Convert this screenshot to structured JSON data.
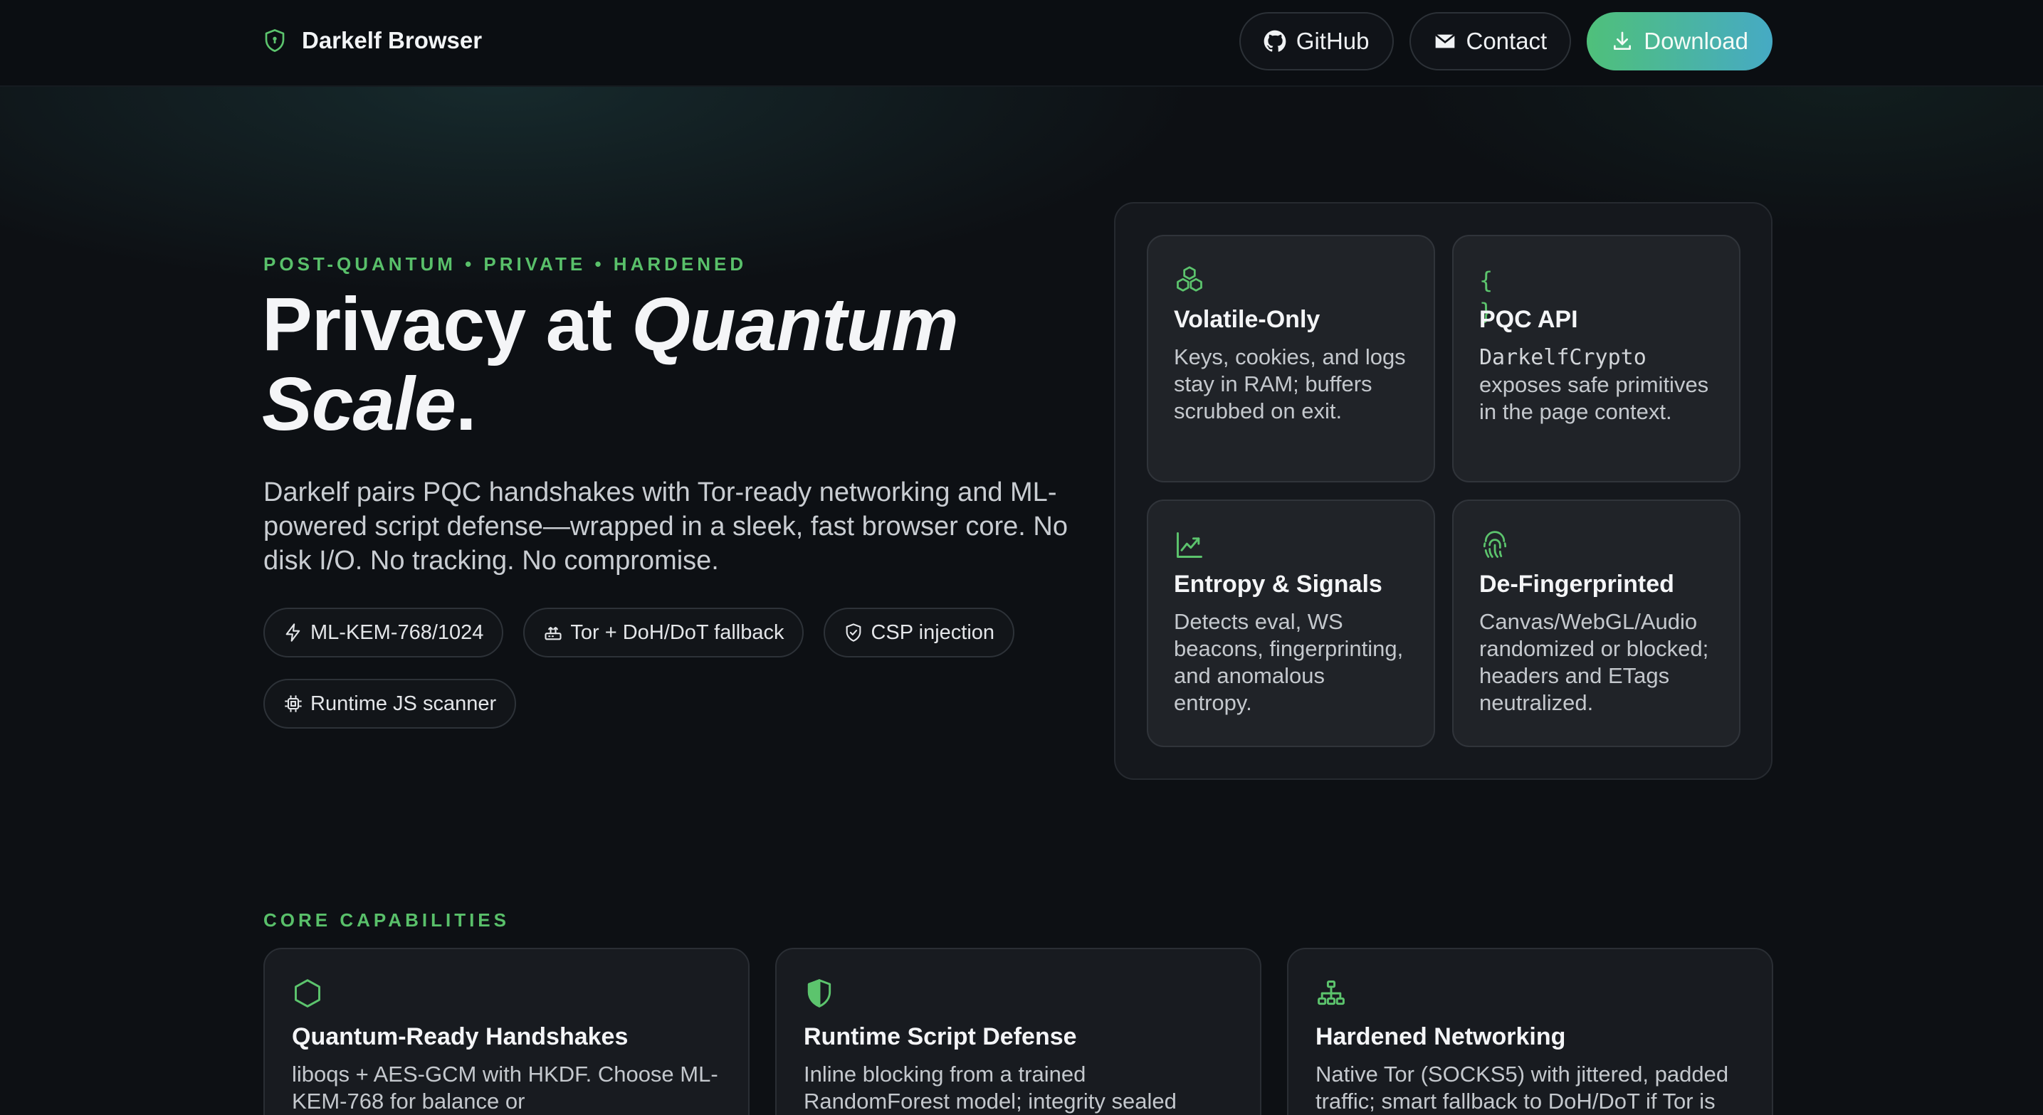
{
  "header": {
    "brand_name": "Darkelf Browser",
    "nav": {
      "github_label": "GitHub",
      "contact_label": "Contact",
      "download_label": "Download"
    }
  },
  "hero": {
    "eyebrow": "POST-QUANTUM • PRIVATE • HARDENED",
    "title_prefix": "Privacy at ",
    "title_emphasis_1": "Quantum",
    "title_emphasis_2": "Scale",
    "title_suffix": ".",
    "lead": "Darkelf pairs PQC handshakes with Tor-ready networking and ML-powered script defense—wrapped in a sleek, fast browser core. No disk I/O. No tracking. No compromise.",
    "chips": [
      {
        "label": "ML-KEM-768/1024",
        "icon": "lightning-icon"
      },
      {
        "label": "Tor + DoH/DoT fallback",
        "icon": "router-icon"
      },
      {
        "label": "CSP injection",
        "icon": "shield-check-icon"
      },
      {
        "label": "Runtime JS scanner",
        "icon": "cpu-icon"
      }
    ]
  },
  "features": [
    {
      "icon": "boxes-icon",
      "title": "Volatile-Only",
      "text": "Keys, cookies, and logs stay in RAM; buffers scrubbed on exit."
    },
    {
      "icon": "braces-icon",
      "icon_glyph": "{ }",
      "title": "PQC API",
      "code": "DarkelfCrypto",
      "text": "exposes safe primitives in the page context."
    },
    {
      "icon": "chart-line-icon",
      "title": "Entropy & Signals",
      "text": "Detects eval, WS beacons, fingerprinting, and anomalous entropy."
    },
    {
      "icon": "fingerprint-icon",
      "title": "De-Fingerprinted",
      "text": "Canvas/WebGL/Audio randomized or blocked; headers and ETags neutralized."
    }
  ],
  "capabilities": {
    "label": "CORE CAPABILITIES",
    "items": [
      {
        "icon": "hexagon-icon",
        "title": "Quantum-Ready Handshakes",
        "text": "liboqs + AES-GCM with HKDF. Choose ML-KEM-768 for balance or"
      },
      {
        "icon": "shield-half-icon",
        "title": "Runtime Script Defense",
        "text": "Inline blocking from a trained RandomForest model; integrity sealed"
      },
      {
        "icon": "network-icon",
        "title": "Hardened Networking",
        "text": "Native Tor (SOCKS5) with jittered, padded traffic; smart fallback to DoH/DoT if Tor is"
      }
    ]
  },
  "colors": {
    "accent": "#59c06a",
    "background": "#0d1014",
    "download_gradient_start": "#4fc07a",
    "download_gradient_end": "#46aac4"
  }
}
